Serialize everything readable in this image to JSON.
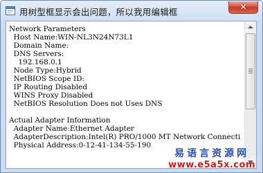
{
  "window": {
    "title": "用树型框显示会出问题，所以我用编辑框",
    "close_glyph": "✕"
  },
  "textbox": {
    "lines": [
      "Network Parameters",
      "  Host Name:WIN-NL3N24N73L1",
      "  Domain Name:",
      "  DNS Servers:",
      "    192.168.0.1",
      "  Node Type:Hybrid",
      "  NetBIOS Scope ID:",
      "  IP Routing Disabled",
      "  WINS Proxy Disabled",
      "  NetBIOS Resolution Does not Uses DNS",
      "",
      "Actual Adapter Information",
      "  Adapter Name:Ethernet Adapter",
      "  AdapterDescription:Intel(R) PRO/1000 MT Network Connecti",
      "  Physical Address:0-12-41-134-55-190"
    ]
  },
  "watermark": {
    "site_name": "易语言资源网",
    "url": "www.e5a5x.com"
  },
  "icons": {
    "title_icon": "window-app-icon",
    "scroll_up": "arrow-up-icon",
    "scroll_down": "arrow-down-icon"
  },
  "colors": {
    "titlebar": "#cfe0f3",
    "close_button": "#c23a26",
    "watermark_text": "#2a4fae",
    "watermark_url": "#c61f1f"
  }
}
